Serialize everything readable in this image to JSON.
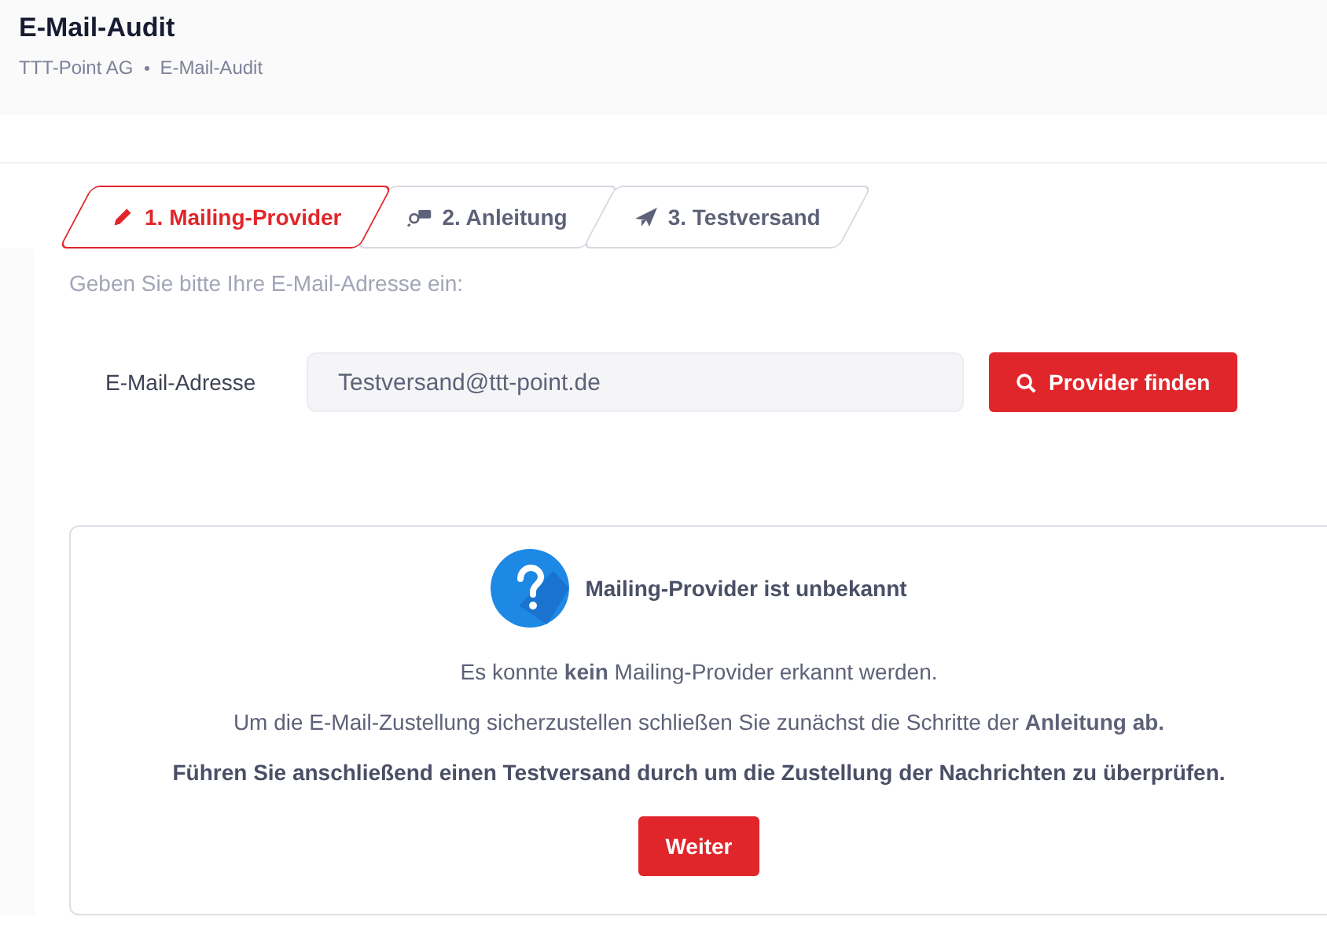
{
  "header": {
    "title": "E-Mail-Audit",
    "breadcrumbs": [
      "TTT-Point AG",
      "E-Mail-Audit"
    ]
  },
  "tabs": [
    {
      "label": "1. Mailing-Provider",
      "kind": "edit",
      "selected": true
    },
    {
      "label": "2. Anleitung",
      "kind": "guide",
      "selected": false
    },
    {
      "label": "3. Testversand",
      "kind": "send",
      "selected": false
    }
  ],
  "instruction": "Geben Sie bitte Ihre E-Mail-Adresse ein:",
  "email_field": {
    "label": "E-Mail-Adresse",
    "value": "Testversand@ttt-point.de"
  },
  "search_button": "Provider finden",
  "result": {
    "title": "Mailing-Provider ist unbekannt",
    "lines": [
      "Es konnte **kein** Mailing-Provider erkannt werden.",
      "Um die E-Mail-Zustellung sicherzustellen schließen Sie zunächst die Schritte der **Anleitung ab.**"
    ],
    "bold_line": "Führen Sie anschließend einen Testversand durch um die Zustellung der Nachrichten zu überprüfen.",
    "button": "Weiter"
  }
}
